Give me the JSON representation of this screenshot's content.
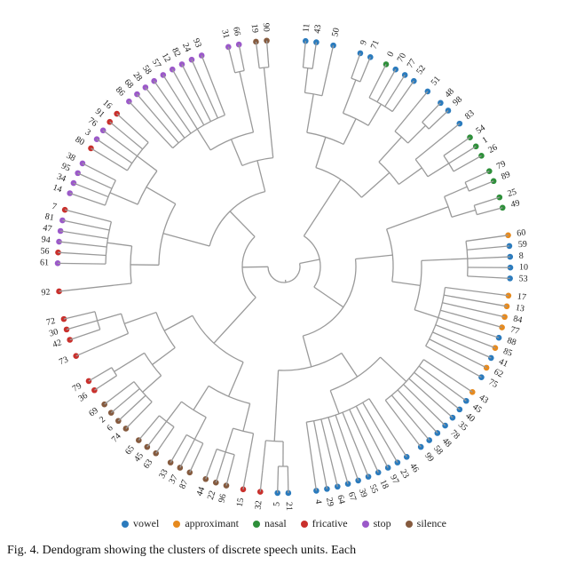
{
  "chart_data": {
    "type": "radial-dendrogram",
    "title": "",
    "legend_title": "",
    "radius_outer": 255,
    "classes": {
      "vowel": {
        "color": "#2b7bbd",
        "label": "vowel"
      },
      "approximant": {
        "color": "#e68a1e",
        "label": "approximant"
      },
      "nasal": {
        "color": "#2e8f3a",
        "label": "nasal"
      },
      "fricative": {
        "color": "#c9302c",
        "label": "fricative"
      },
      "stop": {
        "color": "#9b59c9",
        "label": "stop"
      },
      "silence": {
        "color": "#855a3e",
        "label": "silence"
      }
    },
    "clusters": [
      {
        "labels": [
          "11",
          "43"
        ],
        "classes": [
          "vowel",
          "vowel"
        ],
        "pre": 2
      },
      {
        "labels": [
          "50"
        ],
        "classes": [
          "vowel"
        ]
      },
      {
        "labels": [
          "9",
          "71"
        ],
        "classes": [
          "vowel",
          "vowel"
        ],
        "pre": 1
      },
      {
        "labels": [
          "0",
          "70",
          "77",
          "52"
        ],
        "classes": [
          "nasal",
          "vowel",
          "vowel",
          "vowel"
        ]
      },
      {
        "labels": [
          "51"
        ],
        "classes": [
          "vowel"
        ]
      },
      {
        "labels": [
          "48",
          "98"
        ],
        "classes": [
          "vowel",
          "vowel"
        ]
      },
      {
        "labels": [
          "83"
        ],
        "classes": [
          "vowel"
        ]
      },
      {
        "labels": [
          "54",
          "1",
          "26"
        ],
        "classes": [
          "nasal",
          "nasal",
          "nasal"
        ]
      },
      {
        "labels": [
          "79",
          "89"
        ],
        "classes": [
          "nasal",
          "nasal"
        ]
      },
      {
        "labels": [
          "25",
          "49"
        ],
        "classes": [
          "nasal",
          "nasal"
        ]
      },
      {
        "labels": [
          "60",
          "59",
          "8",
          "10",
          "53"
        ],
        "classes": [
          "approximant",
          "vowel",
          "vowel",
          "vowel",
          "vowel"
        ],
        "pre": 1
      },
      {
        "labels": [
          "17",
          "13",
          "84",
          "77",
          "88",
          "85",
          "41",
          "62",
          "75"
        ],
        "classes": [
          "approximant",
          "approximant",
          "approximant",
          "approximant",
          "vowel",
          "approximant",
          "vowel",
          "approximant",
          "vowel"
        ]
      },
      {
        "labels": [
          "43",
          "45",
          "40",
          "35",
          "78",
          "48",
          "58",
          "99"
        ],
        "classes": [
          "approximant",
          "vowel",
          "vowel",
          "vowel",
          "vowel",
          "vowel",
          "vowel",
          "vowel"
        ]
      },
      {
        "labels": [
          "46",
          "23",
          "97",
          "18",
          "55",
          "39",
          "67",
          "64",
          "29",
          "4"
        ],
        "classes": [
          "vowel",
          "vowel",
          "vowel",
          "vowel",
          "vowel",
          "vowel",
          "vowel",
          "vowel",
          "vowel",
          "vowel"
        ]
      },
      {
        "labels": [
          "21",
          "5"
        ],
        "classes": [
          "vowel",
          "vowel"
        ],
        "pre": 1
      },
      {
        "labels": [
          "32"
        ],
        "classes": [
          "fricative"
        ]
      },
      {
        "labels": [
          "15"
        ],
        "classes": [
          "fricative"
        ]
      },
      {
        "labels": [
          "96",
          "22",
          "44"
        ],
        "classes": [
          "silence",
          "silence",
          "silence"
        ]
      },
      {
        "labels": [
          "87",
          "37",
          "33"
        ],
        "classes": [
          "silence",
          "silence",
          "silence"
        ]
      },
      {
        "labels": [
          "63",
          "45",
          "65"
        ],
        "classes": [
          "silence",
          "silence",
          "silence"
        ]
      },
      {
        "labels": [
          "74",
          "6",
          "2",
          "69"
        ],
        "classes": [
          "silence",
          "silence",
          "silence",
          "silence"
        ]
      },
      {
        "labels": [
          "36",
          "79"
        ],
        "classes": [
          "fricative",
          "fricative"
        ]
      },
      {
        "labels": [
          "73"
        ],
        "classes": [
          "fricative"
        ],
        "pre": 1
      },
      {
        "labels": [
          "42",
          "30",
          "72"
        ],
        "classes": [
          "fricative",
          "fricative",
          "fricative"
        ]
      },
      {
        "labels": [
          "92"
        ],
        "classes": [
          "fricative"
        ],
        "pre": 1
      },
      {
        "labels": [
          "61",
          "56",
          "94",
          "47",
          "81",
          "7"
        ],
        "classes": [
          "stop",
          "fricative",
          "stop",
          "stop",
          "stop",
          "fricative"
        ],
        "pre": 1
      },
      {
        "labels": [
          "14",
          "34",
          "95",
          "38"
        ],
        "classes": [
          "stop",
          "stop",
          "stop",
          "stop"
        ]
      },
      {
        "labels": [
          "80",
          "3",
          "76",
          "91",
          "16"
        ],
        "classes": [
          "fricative",
          "stop",
          "stop",
          "fricative",
          "fricative"
        ]
      },
      {
        "labels": [
          "86",
          "68",
          "28",
          "58",
          "57",
          "12",
          "82",
          "24",
          "93"
        ],
        "classes": [
          "stop",
          "stop",
          "stop",
          "stop",
          "stop",
          "stop",
          "stop",
          "stop",
          "stop"
        ]
      },
      {
        "labels": [
          "31",
          "66"
        ],
        "classes": [
          "stop",
          "stop"
        ],
        "pre": 1
      },
      {
        "labels": [
          "19",
          "90"
        ],
        "classes": [
          "silence",
          "silence"
        ]
      }
    ]
  },
  "legend_order": [
    "vowel",
    "approximant",
    "nasal",
    "fricative",
    "stop",
    "silence"
  ],
  "caption": "Fig. 4.   Dendogram showing the clusters of discrete speech units. Each"
}
